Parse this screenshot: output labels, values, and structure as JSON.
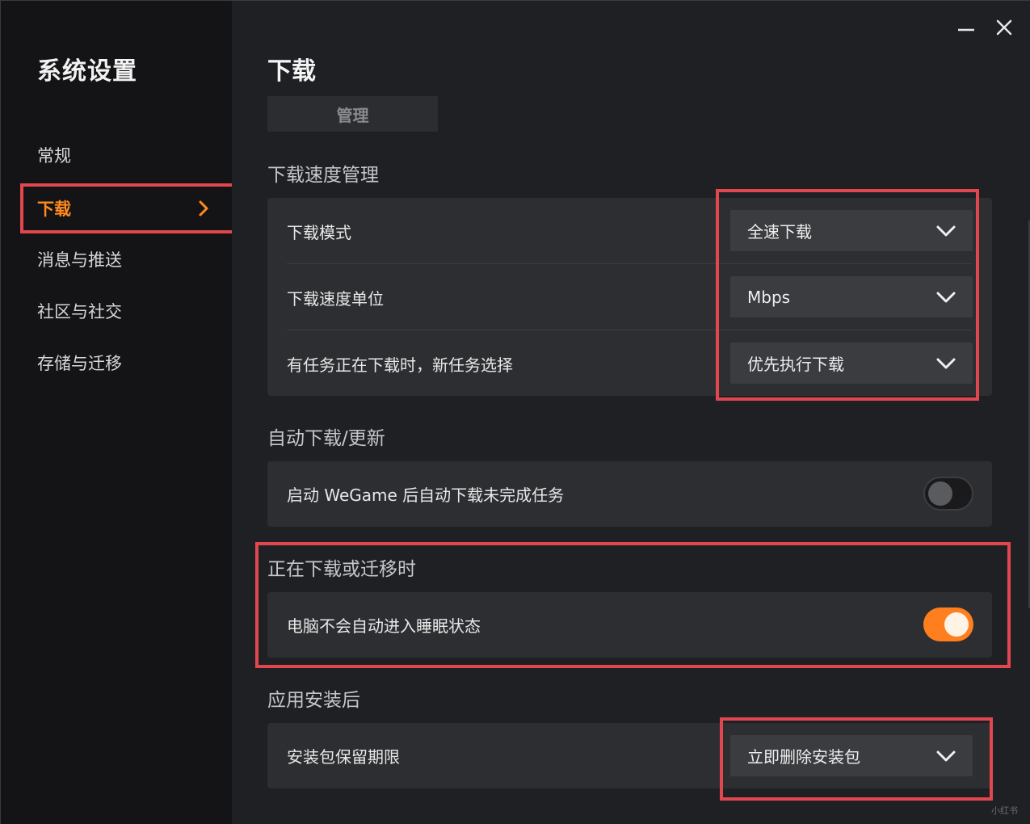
{
  "sidebar": {
    "title": "系统设置",
    "items": [
      {
        "label": "常规"
      },
      {
        "label": "下载"
      },
      {
        "label": "消息与推送"
      },
      {
        "label": "社区与社交"
      },
      {
        "label": "存储与迁移"
      }
    ]
  },
  "main": {
    "title": "下载",
    "manage_label": "管理",
    "speed_section": {
      "title": "下载速度管理",
      "rows": [
        {
          "label": "下载模式",
          "value": "全速下载"
        },
        {
          "label": "下载速度单位",
          "value": "Mbps"
        },
        {
          "label": "有任务正在下载时，新任务选择",
          "value": "优先执行下载"
        }
      ]
    },
    "auto_section": {
      "title": "自动下载/更新",
      "row": {
        "label": "启动 WeGame 后自动下载未完成任务",
        "enabled": false
      }
    },
    "sleep_section": {
      "title": "正在下载或迁移时",
      "row": {
        "label": "电脑不会自动进入睡眠状态",
        "enabled": true
      }
    },
    "install_section": {
      "title": "应用安装后",
      "row": {
        "label": "安装包保留期限",
        "value": "立即删除安装包"
      }
    }
  },
  "watermark": "小红书",
  "colors": {
    "accent": "#ff8a1e",
    "highlight": "#e2474f",
    "toggle_on": "#ff7f1e",
    "background": "#1f2023",
    "sidebar": "#141416",
    "card": "#2d2e31"
  },
  "icons": {
    "minimize": "minimize-icon",
    "close": "close-icon",
    "nav_chevron": "chevron-right-icon",
    "select_chevron": "chevron-down-icon"
  }
}
